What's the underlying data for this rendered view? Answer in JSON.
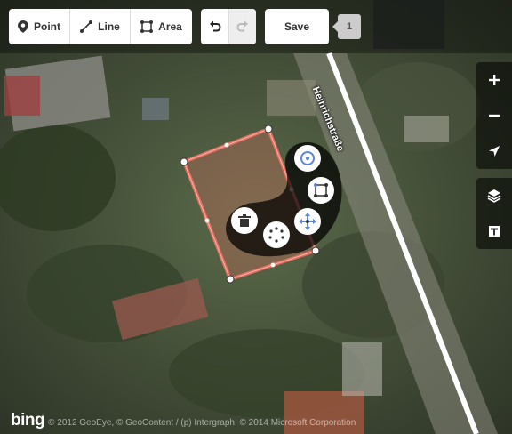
{
  "toolbar": {
    "point_label": "Point",
    "line_label": "Line",
    "area_label": "Area",
    "save_label": "Save",
    "edit_count": "1"
  },
  "map": {
    "street_name": "Heinrichstraße",
    "attribution_logo": "bing",
    "attribution_text": "© 2012 GeoEye, © GeoContent / (p) Intergraph, © 2014 Microsoft Corporation"
  },
  "sidebar": {
    "items": [
      {
        "icon": "zoom-in-icon"
      },
      {
        "icon": "zoom-out-icon"
      },
      {
        "icon": "locate-icon"
      },
      {
        "icon": "layers-icon"
      },
      {
        "icon": "map-data-icon"
      }
    ]
  },
  "radial_menu": {
    "items": [
      "circularize-icon",
      "square-icon",
      "delete-icon",
      "reflect-icon",
      "move-icon"
    ]
  },
  "colors": {
    "selection": "#e06e5f",
    "road": "#ffffff"
  }
}
